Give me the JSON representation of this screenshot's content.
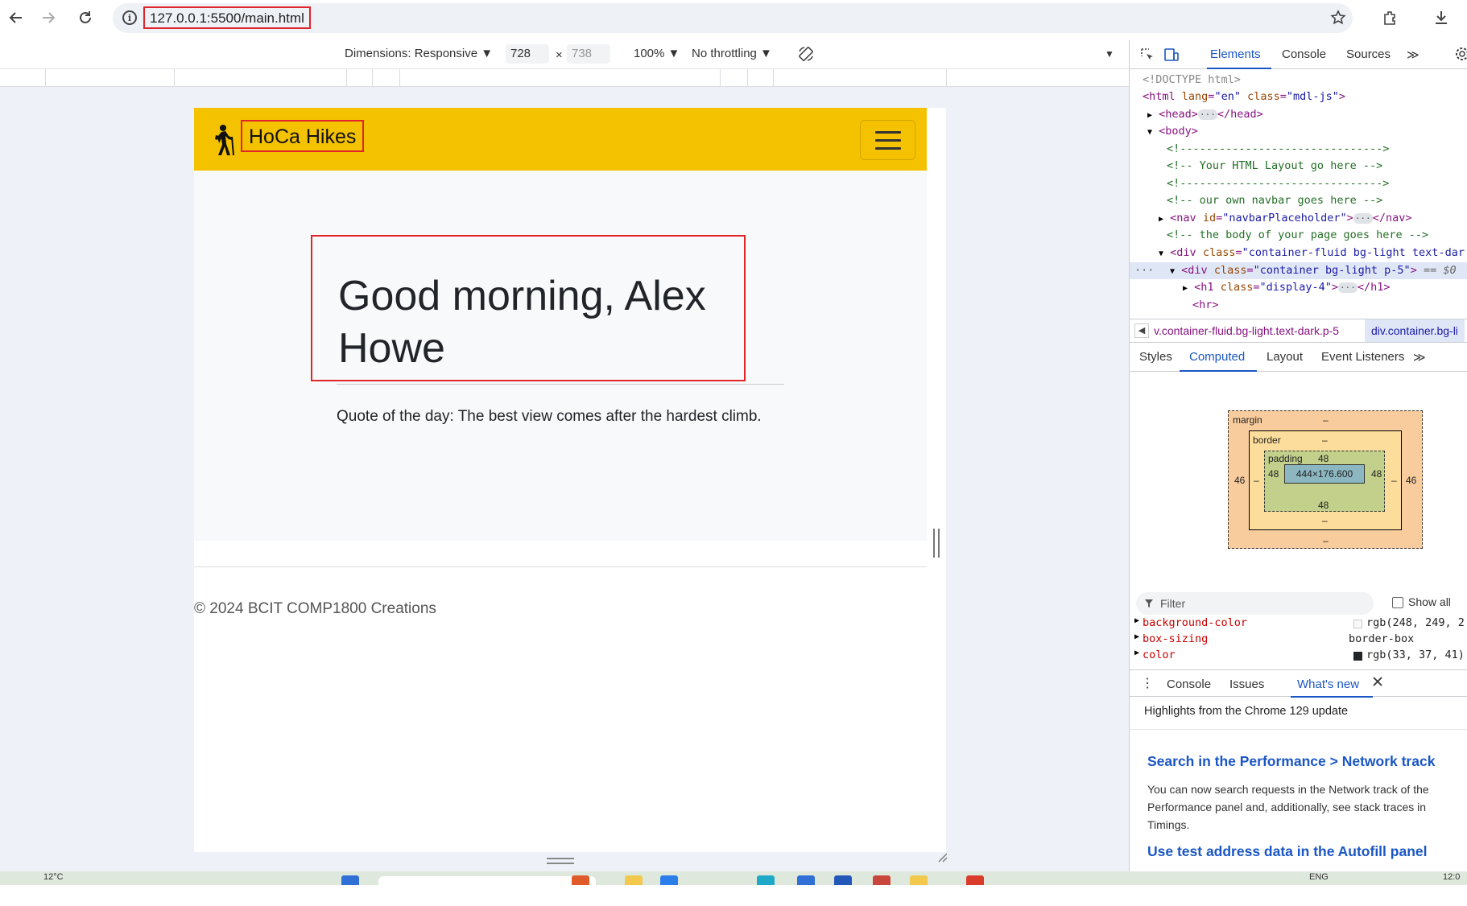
{
  "browser": {
    "url": "127.0.0.1:5500/main.html",
    "icons": [
      "back-arrow-icon",
      "forward-arrow-icon",
      "reload-icon",
      "info-icon",
      "star-icon",
      "extensions-icon",
      "download-icon"
    ]
  },
  "device_toolbar": {
    "dimensions_label": "Dimensions: Responsive ▼",
    "width_value": "728",
    "times": "×",
    "height_value": "738",
    "zoom_label": "100% ▼",
    "throttle_label": "No throttling ▼",
    "more_label": "▼"
  },
  "site": {
    "brand": "HoCa Hikes",
    "greeting": "Good morning, Alex Howe",
    "quote": "Quote of the day: The best view comes after the hardest climb.",
    "footer": "© 2024 BCIT COMP1800 Creations"
  },
  "devtools": {
    "tabs": [
      "Elements",
      "Console",
      "Sources"
    ],
    "more_tabs": "≫",
    "dom": {
      "doctype": "<!DOCTYPE html>",
      "html_tag": "<html",
      "html_lang_attr": "lang",
      "html_lang_val": "\"en\"",
      "html_class_attr": "class",
      "html_class_val": "\"mdl-js\"",
      "html_close": ">",
      "head": "<head>",
      "head_close": "</head>",
      "body": "<body>",
      "comment1": "<!------------------------------->",
      "comment2": "<!-- Your HTML Layout go here -->",
      "comment3": "<!------------------------------->",
      "comment4": "<!-- our own navbar goes here -->",
      "nav_open": "<nav",
      "nav_id_attr": "id",
      "nav_id_val": "\"navbarPlaceholder\"",
      "nav_gt": ">",
      "nav_close": "</nav>",
      "comment5": "<!-- the body of your page goes here -->",
      "div1_open": "<div",
      "div1_class_attr": "class",
      "div1_class_val": "\"container-fluid bg-light text-dar",
      "div2_open": "<div",
      "div2_class_attr": "class",
      "div2_class_val": "\"container bg-light p-5\"",
      "div2_gt": ">",
      "div2_eq": "== $0",
      "h1_open": "<h1",
      "h1_class_attr": "class",
      "h1_class_val": "\"display-4\"",
      "h1_gt": ">",
      "h1_close": "</h1>",
      "hr": "<hr>",
      "ellipsis": "···"
    },
    "breadcrumb_1": "v.container-fluid.bg-light.text-dark.p-5",
    "breadcrumb_2": "div.container.bg-li",
    "side_tabs": [
      "Styles",
      "Computed",
      "Layout",
      "Event Listeners"
    ],
    "box_model": {
      "margin_label": "margin",
      "margin_top": "–",
      "margin_bottom": "–",
      "margin_left": "46",
      "margin_right": "46",
      "border_label": "border",
      "border_top": "–",
      "border_bottom": "–",
      "border_left": "–",
      "border_right": "–",
      "padding_label": "padding",
      "padding_top": "48",
      "padding_bottom": "48",
      "padding_left": "48",
      "padding_right": "48",
      "content": "444×176.600"
    },
    "filter_placeholder": "Filter",
    "show_all": "Show all",
    "properties": [
      {
        "name": "background-color",
        "value": "rgb(248, 249, 2"
      },
      {
        "name": "box-sizing",
        "value": "border-box"
      },
      {
        "name": "color",
        "value": "rgb(33, 37, 41)"
      }
    ],
    "drawer_tabs": [
      "Console",
      "Issues",
      "What's new"
    ],
    "whats_new": {
      "highlight": "Highlights from the Chrome 129 update",
      "heading1": "Search in the Performance > Network track",
      "body1": "You can now search requests in the Network track of the Performance panel and, additionally, see stack traces in Timings.",
      "heading2": "Use test address data in the Autofill panel"
    }
  },
  "taskbar": {
    "temp": "12°C",
    "lang": "ENG",
    "time": "12:0"
  },
  "colors": {
    "navbar": "#f5c200",
    "highlight_outline": "#e0242a",
    "devtools_accent": "#1a56c4"
  }
}
